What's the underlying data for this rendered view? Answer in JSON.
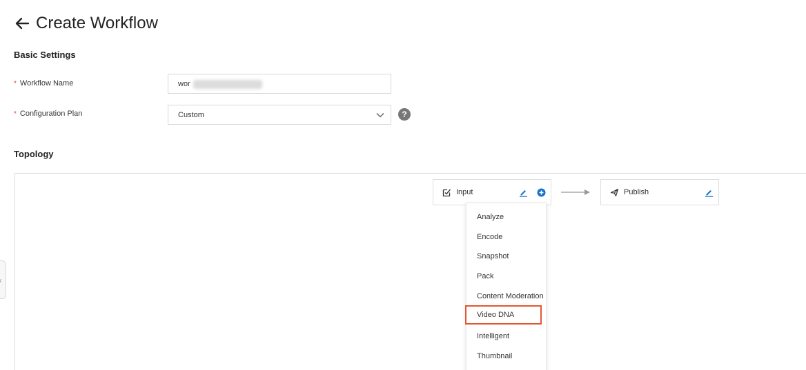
{
  "header": {
    "title": "Create Workflow",
    "back_icon": "arrow-left-icon"
  },
  "basic_settings": {
    "title": "Basic Settings",
    "workflow_name": {
      "label": "Workflow Name",
      "required_mark": "*",
      "value": "wor"
    },
    "configuration_plan": {
      "label": "Configuration Plan",
      "required_mark": "*",
      "value": "Custom",
      "help": "?"
    }
  },
  "topology": {
    "title": "Topology",
    "side_toggle": "«",
    "nodes": [
      {
        "label": "Input",
        "icon": "checkbox-edit-icon"
      },
      {
        "label": "Publish",
        "icon": "paper-plane-icon"
      }
    ],
    "add_menu": {
      "items": [
        "Analyze",
        "Encode",
        "Snapshot",
        "Pack",
        "Content Moderation",
        "Video DNA",
        "Intelligent",
        "Thumbnail"
      ],
      "highlighted": "Video DNA"
    }
  },
  "colors": {
    "accent": "#1a73c9",
    "highlight_border": "#e4552e",
    "required": "#e23a2e"
  }
}
